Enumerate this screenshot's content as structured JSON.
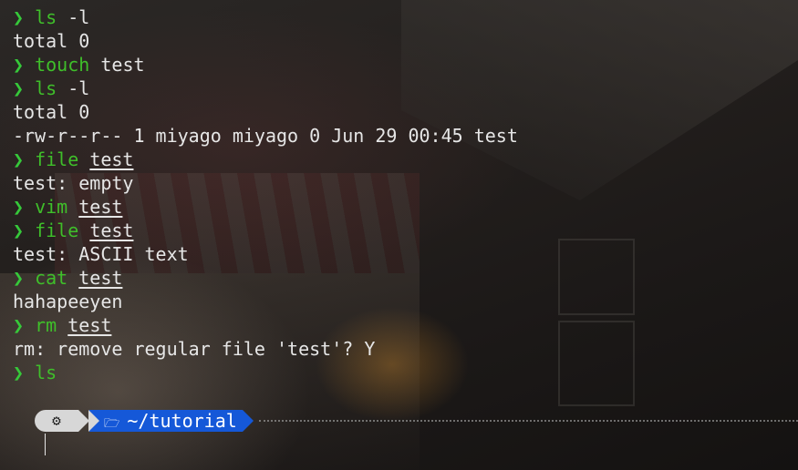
{
  "session": [
    {
      "type": "cmd",
      "prompt": "❯",
      "command": "ls",
      "args": [
        {
          "text": "-l",
          "path": false
        }
      ]
    },
    {
      "type": "out",
      "text": "total 0"
    },
    {
      "type": "cmd",
      "prompt": "❯",
      "command": "touch",
      "args": [
        {
          "text": "test",
          "path": false
        }
      ]
    },
    {
      "type": "cmd",
      "prompt": "❯",
      "command": "ls",
      "args": [
        {
          "text": "-l",
          "path": false
        }
      ]
    },
    {
      "type": "out",
      "text": "total 0"
    },
    {
      "type": "out",
      "text": "-rw-r--r-- 1 miyago miyago 0 Jun 29 00:45 test"
    },
    {
      "type": "cmd",
      "prompt": "❯",
      "command": "file",
      "args": [
        {
          "text": "test",
          "path": true
        }
      ]
    },
    {
      "type": "out",
      "text": "test: empty"
    },
    {
      "type": "cmd",
      "prompt": "❯",
      "command": "vim",
      "args": [
        {
          "text": "test",
          "path": true
        }
      ]
    },
    {
      "type": "cmd",
      "prompt": "❯",
      "command": "file",
      "args": [
        {
          "text": "test",
          "path": true
        }
      ]
    },
    {
      "type": "out",
      "text": "test: ASCII text"
    },
    {
      "type": "cmd",
      "prompt": "❯",
      "command": "cat",
      "args": [
        {
          "text": "test",
          "path": true
        }
      ]
    },
    {
      "type": "out",
      "text": "hahapeeyen"
    },
    {
      "type": "cmd",
      "prompt": "❯",
      "command": "rm",
      "args": [
        {
          "text": "test",
          "path": true
        }
      ]
    },
    {
      "type": "out",
      "text": "rm: remove regular file 'test'? Y"
    },
    {
      "type": "cmd",
      "prompt": "❯",
      "command": "ls",
      "args": []
    }
  ],
  "prompt_bar": {
    "os_icon": "gear-icon",
    "os_glyph": "⚙",
    "folder_icon": "folder-icon",
    "folder_glyph": "🗁",
    "directory": "~/tutorial"
  },
  "colors": {
    "prompt": "#36c93a",
    "command": "#3fbf2a",
    "text": "#e6e6e6",
    "os_segment": "#d7d7d7",
    "dir_segment": "#1558d8"
  }
}
